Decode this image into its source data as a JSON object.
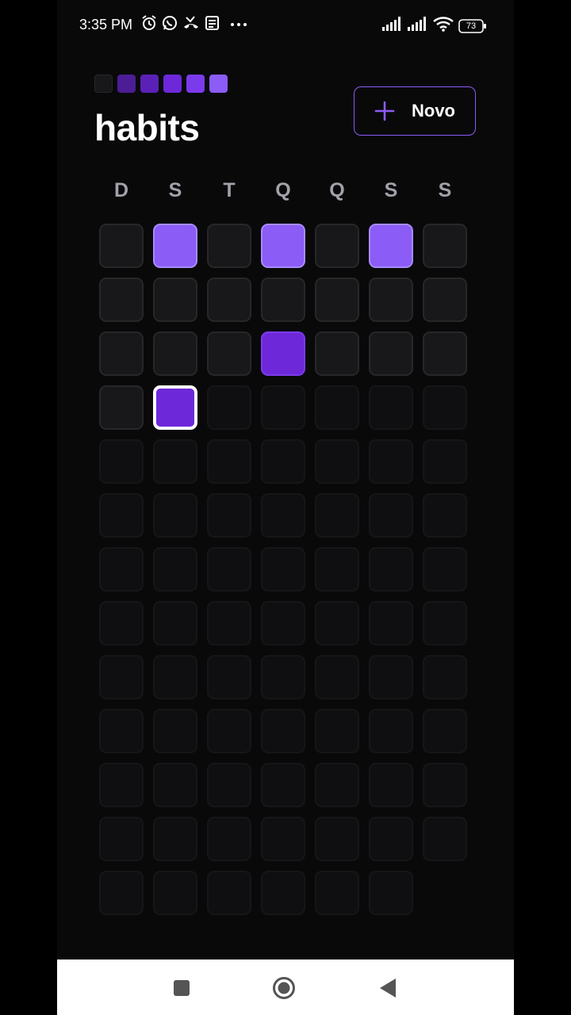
{
  "status_bar": {
    "time": "3:35 PM",
    "left_icons": [
      "alarm-icon",
      "whatsapp-icon",
      "missed-call-icon",
      "news-icon",
      "more-dots-icon"
    ],
    "right_icons": [
      "signal-icon",
      "signal-icon",
      "wifi-icon",
      "battery-icon"
    ],
    "battery": "73"
  },
  "header": {
    "logo_colors": [
      "#18181b",
      "#4c1d95",
      "#5b21b6",
      "#6d28d9",
      "#7c3aed",
      "#8b5cf6"
    ],
    "title": "habits",
    "new_button_label": "Novo",
    "new_button_icon": "plus-icon",
    "accent": "#8b5cf6"
  },
  "week_days": [
    "D",
    "S",
    "T",
    "Q",
    "Q",
    "S",
    "S"
  ],
  "grid": {
    "past_or_today_count": 23,
    "total_count": 90,
    "completion_levels": [
      0,
      3,
      0,
      3,
      0,
      3,
      0,
      0,
      0,
      0,
      0,
      0,
      0,
      0,
      0,
      0,
      0,
      2,
      0,
      0,
      0,
      0,
      2
    ],
    "today_index": 22
  },
  "nav_bar": {
    "buttons": [
      "recents-icon",
      "home-icon",
      "back-icon"
    ]
  }
}
